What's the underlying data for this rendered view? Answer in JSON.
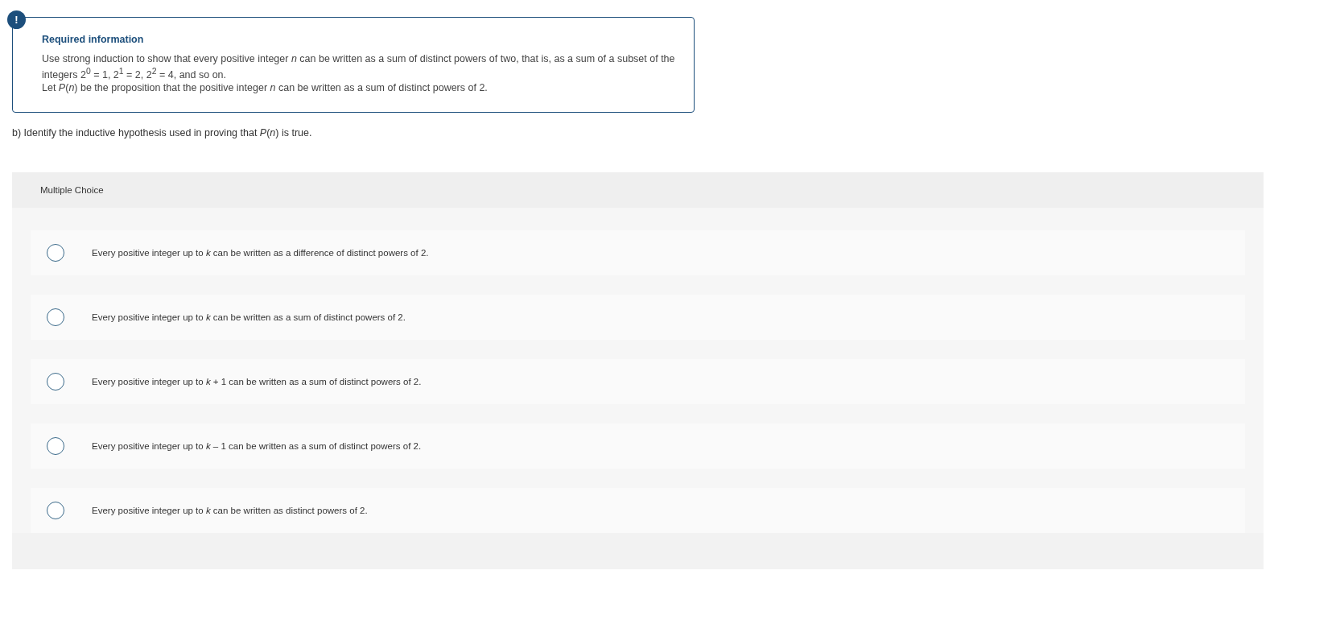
{
  "info": {
    "badge": "!",
    "title": "Required information",
    "paragraphs": [
      "Use strong induction to show that every positive integer *n* can be written as a sum of distinct powers of two, that is, as a sum of a subset of the integers 2$^{0}$ = 1, 2$^{1}$ = 2, 2$^{2}$ = 4, and so on.",
      "Let *P*(*n*) be the proposition that the positive integer *n* can be written as a sum of distinct powers of 2."
    ]
  },
  "question": "b) Identify the inductive hypothesis used in proving that *P*(*n*) is true.",
  "choices": {
    "header": "Multiple Choice",
    "options": [
      {
        "text": "Every positive integer up to *k* can be written as a difference of distinct powers of 2.",
        "selected": false
      },
      {
        "text": "Every positive integer up to *k* can be written as a sum of distinct powers of 2.",
        "selected": false
      },
      {
        "text": "Every positive integer up to *k* + 1 can be written as a sum of distinct powers of 2.",
        "selected": false
      },
      {
        "text": "Every positive integer up to *k* – 1 can be written as a sum of distinct powers of 2.",
        "selected": false
      },
      {
        "text": "Every positive integer up to *k* can be written as distinct powers of 2.",
        "selected": false
      }
    ]
  }
}
